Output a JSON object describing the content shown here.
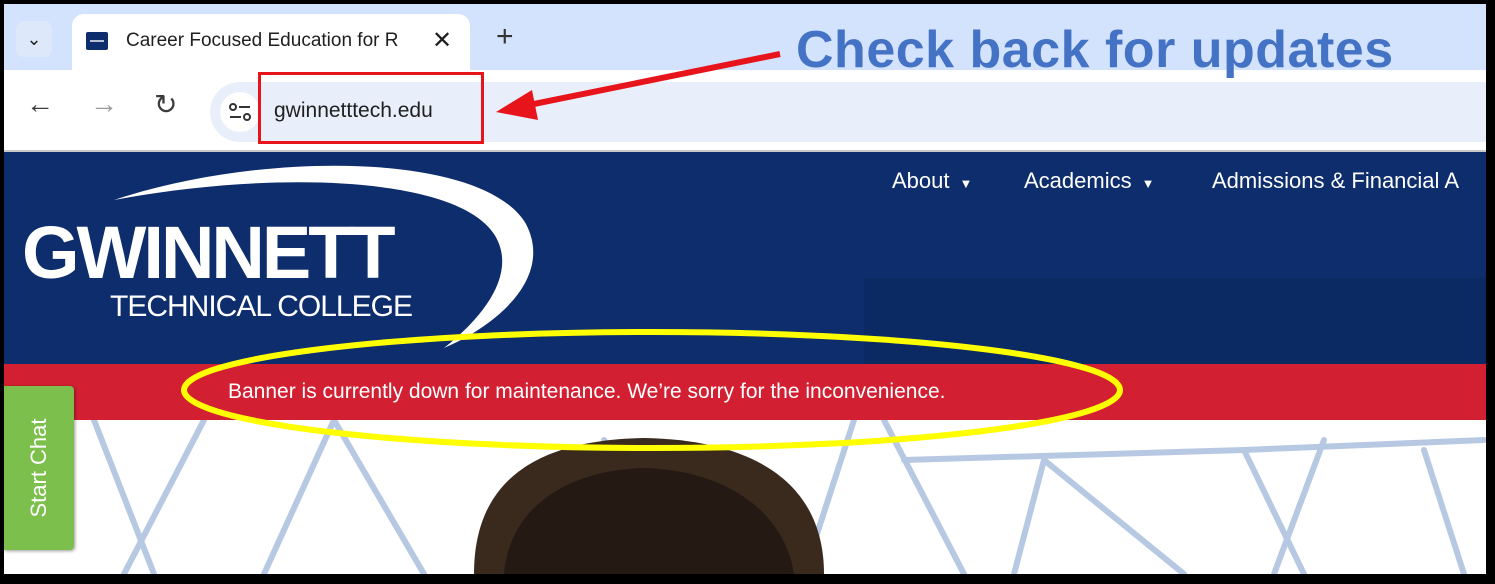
{
  "browser": {
    "tab_title": "Career Focused Education for R",
    "url": "gwinnetttech.edu"
  },
  "site": {
    "logo_line1": "GWINNETT",
    "logo_line2": "TECHNICAL COLLEGE",
    "nav": [
      {
        "label": "About",
        "caret": "▼"
      },
      {
        "label": "Academics",
        "caret": "▼"
      },
      {
        "label": "Admissions & Financial A"
      }
    ],
    "alert": "Banner is currently down for maintenance. We’re sorry for the inconvenience.",
    "chat_label": "Start Chat"
  },
  "annotations": {
    "callout": "Check back for updates",
    "box_color": "#e8141b",
    "callout_color": "#4472c4",
    "ellipse_color": "#ffff00"
  },
  "colors": {
    "header_bg": "#0d2d6c",
    "alert_bg": "#d31f32",
    "chat_bg": "#7cbf4c"
  }
}
